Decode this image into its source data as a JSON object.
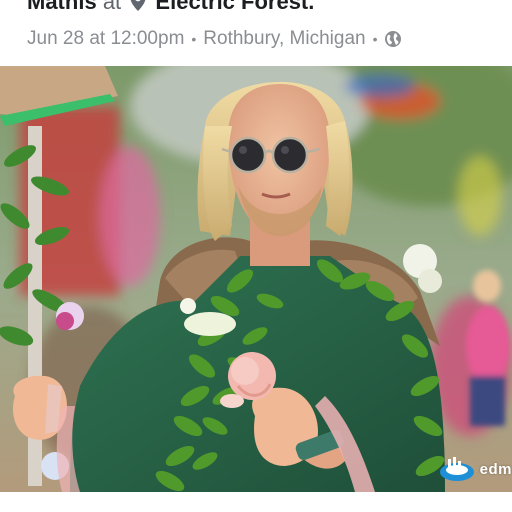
{
  "post": {
    "author_name": "Mathis",
    "at_word": "at",
    "location_name": "Electric Forest",
    "location_suffix": ".",
    "date_time": "Jun 28 at 12:00pm",
    "place": "Rothbury, Michigan",
    "separator": "•",
    "privacy_icon": "globe-icon",
    "location_icon": "map-pin-icon"
  },
  "photo": {
    "watermark_text": "edm",
    "watermark_logo": "edm-logo-icon"
  },
  "colors": {
    "title_text": "#1c1e21",
    "meta_text": "#8a8d91",
    "cloak_green": "#2d6b4a",
    "lei_green": "#4f9a2a",
    "background": "#ffffff"
  }
}
